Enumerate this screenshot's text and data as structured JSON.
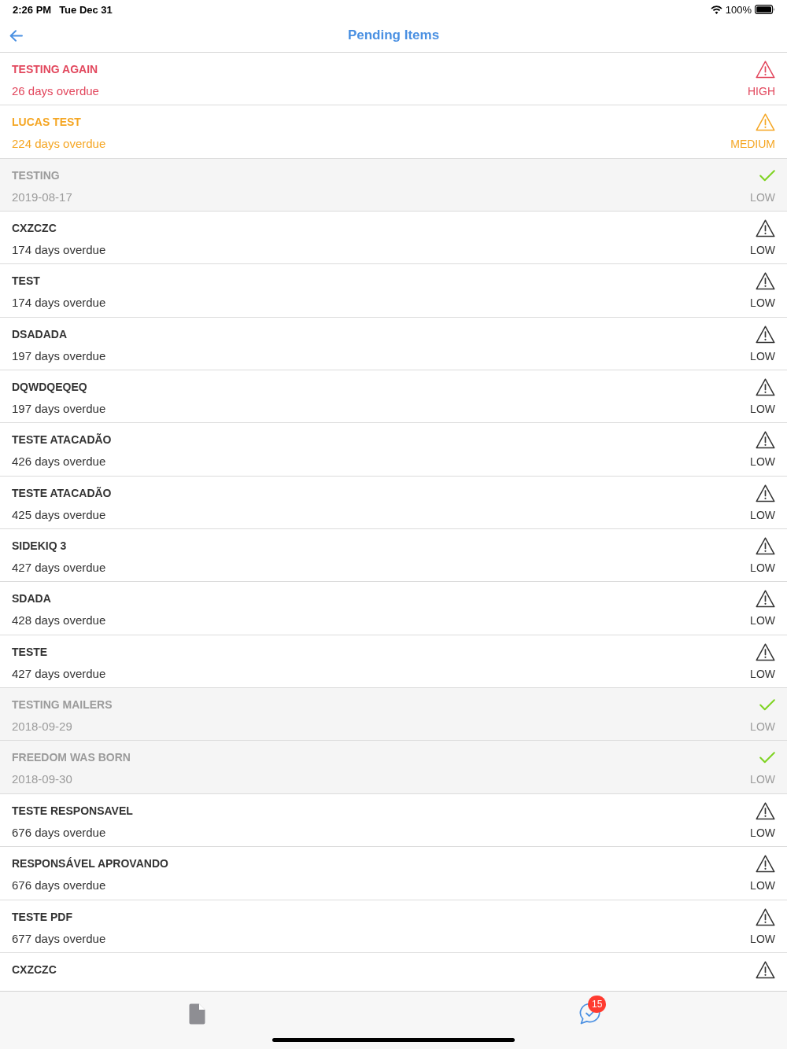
{
  "status_bar": {
    "time": "2:26 PM",
    "date": "Tue Dec 31",
    "battery": "100%"
  },
  "nav_bar": {
    "title": "Pending Items"
  },
  "rows": [
    {
      "title": "TESTING AGAIN",
      "subtitle": "26 days overdue",
      "priority": "HIGH",
      "kind": "high",
      "completed": false
    },
    {
      "title": "LUCAS TEST",
      "subtitle": "224 days overdue",
      "priority": "MEDIUM",
      "kind": "medium",
      "completed": false
    },
    {
      "title": "TESTING",
      "subtitle": "2019-08-17",
      "priority": "LOW",
      "completed": true
    },
    {
      "title": "CXZCZC",
      "subtitle": "174 days overdue",
      "priority": "LOW",
      "kind": "low",
      "completed": false
    },
    {
      "title": "TEST",
      "subtitle": "174 days overdue",
      "priority": "LOW",
      "kind": "low",
      "completed": false
    },
    {
      "title": "DSADADA",
      "subtitle": "197 days overdue",
      "priority": "LOW",
      "kind": "low",
      "completed": false
    },
    {
      "title": "DQWDQEQEQ",
      "subtitle": "197 days overdue",
      "priority": "LOW",
      "kind": "low",
      "completed": false
    },
    {
      "title": "TESTE ATACADÃO",
      "subtitle": "426 days overdue",
      "priority": "LOW",
      "kind": "low",
      "completed": false
    },
    {
      "title": "TESTE ATACADÃO",
      "subtitle": "425 days overdue",
      "priority": "LOW",
      "kind": "low",
      "completed": false
    },
    {
      "title": "SIDEKIQ 3",
      "subtitle": "427 days overdue",
      "priority": "LOW",
      "kind": "low",
      "completed": false
    },
    {
      "title": "SDADA",
      "subtitle": "428 days overdue",
      "priority": "LOW",
      "kind": "low",
      "completed": false
    },
    {
      "title": "TESTE",
      "subtitle": "427 days overdue",
      "priority": "LOW",
      "kind": "low",
      "completed": false
    },
    {
      "title": "TESTING MAILERS",
      "subtitle": "2018-09-29",
      "priority": "LOW",
      "completed": true
    },
    {
      "title": "FREEDOM WAS BORN",
      "subtitle": "2018-09-30",
      "priority": "LOW",
      "completed": true
    },
    {
      "title": "TESTE RESPONSAVEL",
      "subtitle": "676 days overdue",
      "priority": "LOW",
      "kind": "low",
      "completed": false
    },
    {
      "title": "RESPONSÁVEL APROVANDO",
      "subtitle": "676 days overdue",
      "priority": "LOW",
      "kind": "low",
      "completed": false
    },
    {
      "title": "TESTE PDF",
      "subtitle": "677 days overdue",
      "priority": "LOW",
      "kind": "low",
      "completed": false
    },
    {
      "title": "CXZCZC",
      "kind": "low",
      "completed": false
    }
  ],
  "tab_bar": {
    "tabs": [
      {
        "kind": "document",
        "selected": false
      },
      {
        "kind": "chat-check",
        "selected": true,
        "badge": "15"
      }
    ]
  }
}
